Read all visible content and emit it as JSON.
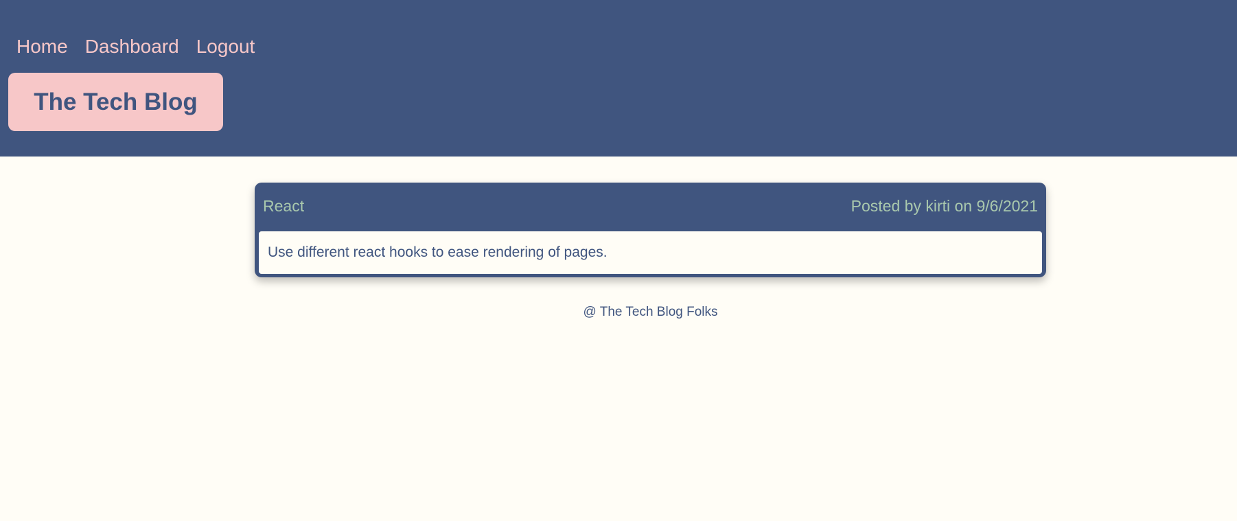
{
  "nav": {
    "items": [
      {
        "label": "Home"
      },
      {
        "label": "Dashboard"
      },
      {
        "label": "Logout"
      }
    ]
  },
  "brand": {
    "title": "The Tech Blog"
  },
  "post": {
    "title": "React",
    "meta": "Posted by kirti on 9/6/2021",
    "body": "Use different react hooks to ease rendering of pages."
  },
  "footer": {
    "text": "@ The Tech Blog Folks"
  },
  "colors": {
    "header_bg": "#40557f",
    "accent_pink": "#f7c7c8",
    "meta_green": "#a9c8ad",
    "page_bg": "#fffdf6"
  }
}
